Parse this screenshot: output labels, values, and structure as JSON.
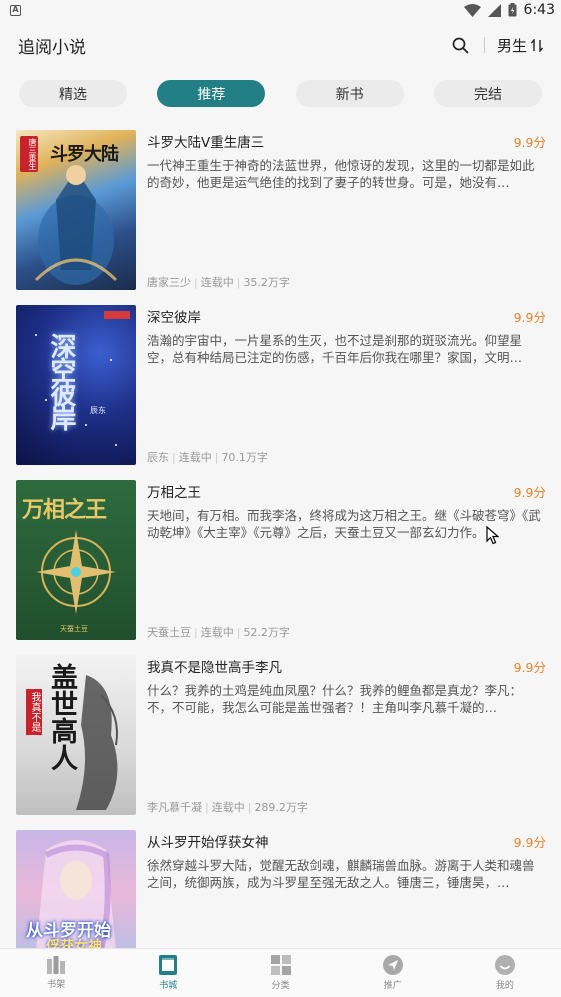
{
  "status_bar": {
    "app_badge": "A",
    "time": "6:43"
  },
  "app_bar": {
    "title": "追阅小说",
    "gender_label": "男生"
  },
  "tabs": [
    {
      "label": "精选",
      "active": false
    },
    {
      "label": "推荐",
      "active": true
    },
    {
      "label": "新书",
      "active": false
    },
    {
      "label": "完结",
      "active": false
    }
  ],
  "books": [
    {
      "title": "斗罗大陆V重生唐三",
      "score": "9.9分",
      "description": "一代神王重生于神奇的法蓝世界，他惊讶的发现，这里的一切都是如此的奇妙，他更是运气绝佳的找到了妻子的转世身。可是，她没有…",
      "author": "唐家三少",
      "status": "连载中",
      "words": "35.2万字",
      "cover_text": "斗罗大陆",
      "cover_badge": "唐三重生"
    },
    {
      "title": "深空彼岸",
      "score": "9.9分",
      "description": "浩瀚的宇宙中，一片星系的生灭，也不过是刹那的斑驳流光。仰望星空，总有种结局已注定的伤感，千百年后你我在哪里？家国，文明…",
      "author": "辰东",
      "status": "连载中",
      "words": "70.1万字",
      "cover_text": "深空彼岸",
      "cover_badge": "辰东"
    },
    {
      "title": "万相之王",
      "score": "9.9分",
      "description": "天地间，有万相。而我李洛，终将成为这万相之王。继《斗破苍穹》《武动乾坤》《大主宰》《元尊》之后，天蚕土豆又一部玄幻力作。",
      "author": "天蚕土豆",
      "status": "连载中",
      "words": "52.2万字",
      "cover_text": "万相之王",
      "cover_badge": "天蚕土豆"
    },
    {
      "title": "我真不是隐世高手李凡",
      "score": "9.9分",
      "description": "什么？我养的土鸡是纯血凤凰？什么？我养的鲤鱼都是真龙？李凡：不，不可能，我怎么可能是盖世强者？！主角叫李凡慕千凝的…",
      "author": "李凡慕千凝",
      "status": "连载中",
      "words": "289.2万字",
      "cover_text": "盖世高人",
      "cover_badge": "我真不是"
    },
    {
      "title": "从斗罗开始俘获女神",
      "score": "9.9分",
      "description": "徐然穿越斗罗大陆，觉醒无敌剑魂，麒麟瑞兽血脉。游离于人类和魂兽之间，统御两族，成为斗罗星至强无敌之人。锤唐三，锤唐昊，…",
      "author": "",
      "status": "",
      "words": "",
      "cover_text": "从斗罗开始",
      "cover_badge": "俘获女神"
    }
  ],
  "bottom_nav": [
    {
      "label": "书架",
      "icon": "bookshelf-icon",
      "active": false
    },
    {
      "label": "书城",
      "icon": "book-store-icon",
      "active": true
    },
    {
      "label": "分类",
      "icon": "category-icon",
      "active": false
    },
    {
      "label": "推广",
      "icon": "promote-icon",
      "active": false
    },
    {
      "label": "我的",
      "icon": "profile-icon",
      "active": false
    }
  ],
  "colors": {
    "accent": "#227f86",
    "score": "#e8832a",
    "background": "#f6f6f6"
  }
}
